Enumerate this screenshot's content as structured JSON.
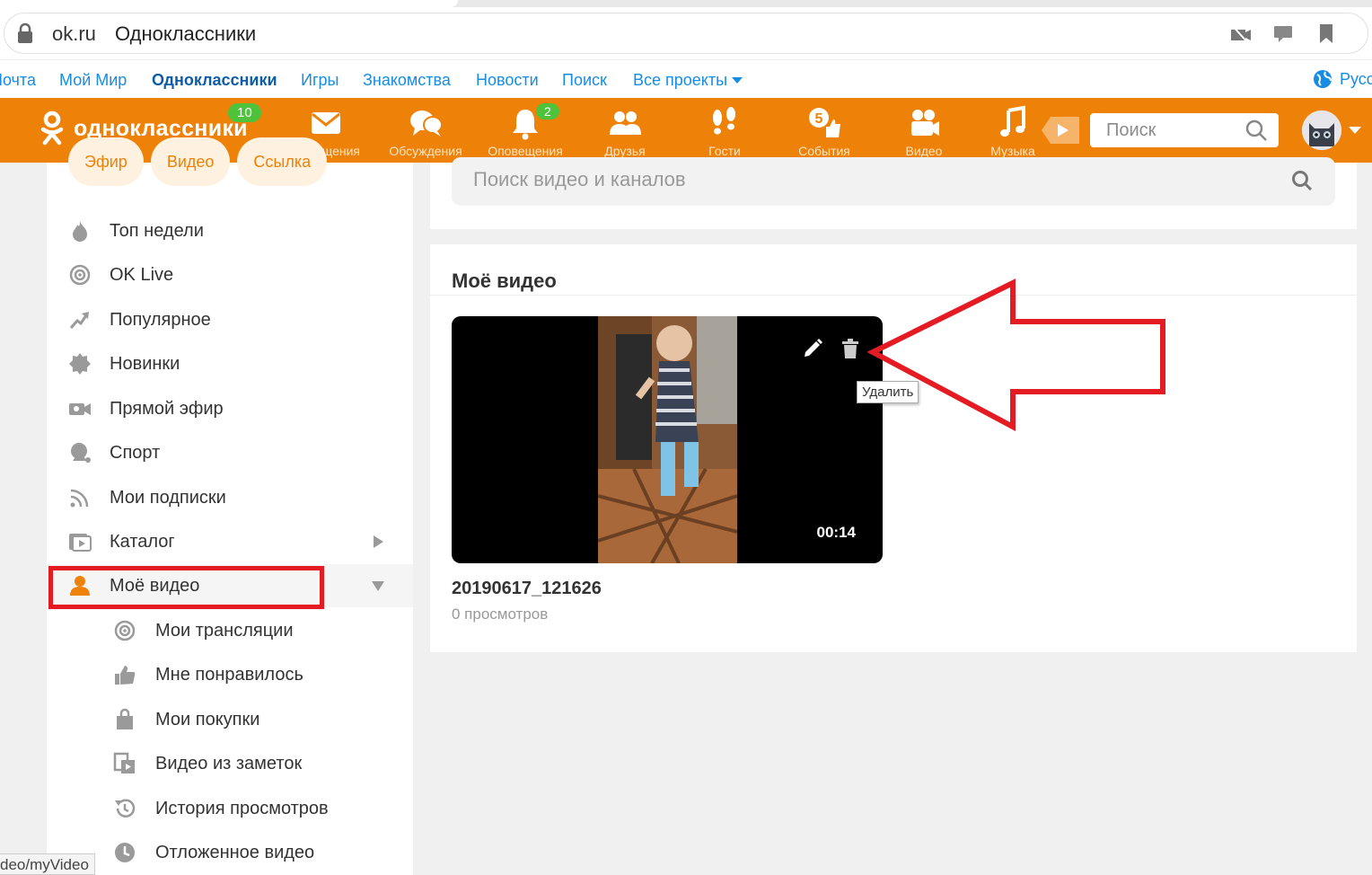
{
  "browser": {
    "host": "ok.ru",
    "page_title": "Одноклассники"
  },
  "projects_bar": {
    "links": [
      "Почта",
      "Мой Мир",
      "Одноклассники",
      "Игры",
      "Знакомства",
      "Новости",
      "Поиск",
      "Все проекты"
    ],
    "active": "Одноклассники",
    "language": "Русс"
  },
  "toolbar": {
    "logo_text": "одноклассники",
    "logo_badge": "10",
    "nav": [
      {
        "label": "Сообщения",
        "icon": "envelope-icon",
        "badge": ""
      },
      {
        "label": "Обсуждения",
        "icon": "chat-bubbles-icon",
        "badge": ""
      },
      {
        "label": "Оповещения",
        "icon": "bell-icon",
        "badge": "2"
      },
      {
        "label": "Друзья",
        "icon": "friends-icon",
        "badge": ""
      },
      {
        "label": "Гости",
        "icon": "footprints-icon",
        "badge": ""
      },
      {
        "label": "События",
        "icon": "events-like-icon",
        "badge": "5"
      },
      {
        "label": "Видео",
        "icon": "video-camera-icon",
        "badge": ""
      },
      {
        "label": "Музыка",
        "icon": "music-note-icon",
        "badge": ""
      }
    ],
    "search_placeholder": "Поиск"
  },
  "sidebar": {
    "pills": [
      "Эфир",
      "Видео",
      "Ссылка"
    ],
    "items": [
      {
        "label": "Топ недели",
        "icon": "flame-icon"
      },
      {
        "label": "OK Live",
        "icon": "live-broadcast-icon"
      },
      {
        "label": "Популярное",
        "icon": "trending-arrow-icon"
      },
      {
        "label": "Новинки",
        "icon": "new-badge-icon"
      },
      {
        "label": "Прямой эфир",
        "icon": "live-camera-icon"
      },
      {
        "label": "Спорт",
        "icon": "sport-icon"
      },
      {
        "label": "Мои подписки",
        "icon": "rss-icon"
      },
      {
        "label": "Каталог",
        "icon": "catalog-icon"
      },
      {
        "label": "Моё видео",
        "icon": "person-icon"
      }
    ],
    "sub_items": [
      {
        "label": "Мои трансляции",
        "icon": "broadcast-icon"
      },
      {
        "label": "Мне понравилось",
        "icon": "thumbs-up-icon"
      },
      {
        "label": "Мои покупки",
        "icon": "shopping-bag-icon"
      },
      {
        "label": "Видео из заметок",
        "icon": "notes-video-icon"
      },
      {
        "label": "История просмотров",
        "icon": "history-icon"
      },
      {
        "label": "Отложенное видео",
        "icon": "clock-icon"
      }
    ]
  },
  "main": {
    "search_placeholder": "Поиск видео и каналов",
    "section_title": "Моё видео",
    "video": {
      "title": "20190617_121626",
      "views": "0 просмотров",
      "duration": "00:14",
      "tooltip": "Удалить"
    }
  },
  "status_url": "deo/myVideo",
  "colors": {
    "ok_orange": "#ee8208",
    "link_blue": "#168de2",
    "badge_green": "#4ec23a",
    "annotation_red": "#e51b23"
  }
}
